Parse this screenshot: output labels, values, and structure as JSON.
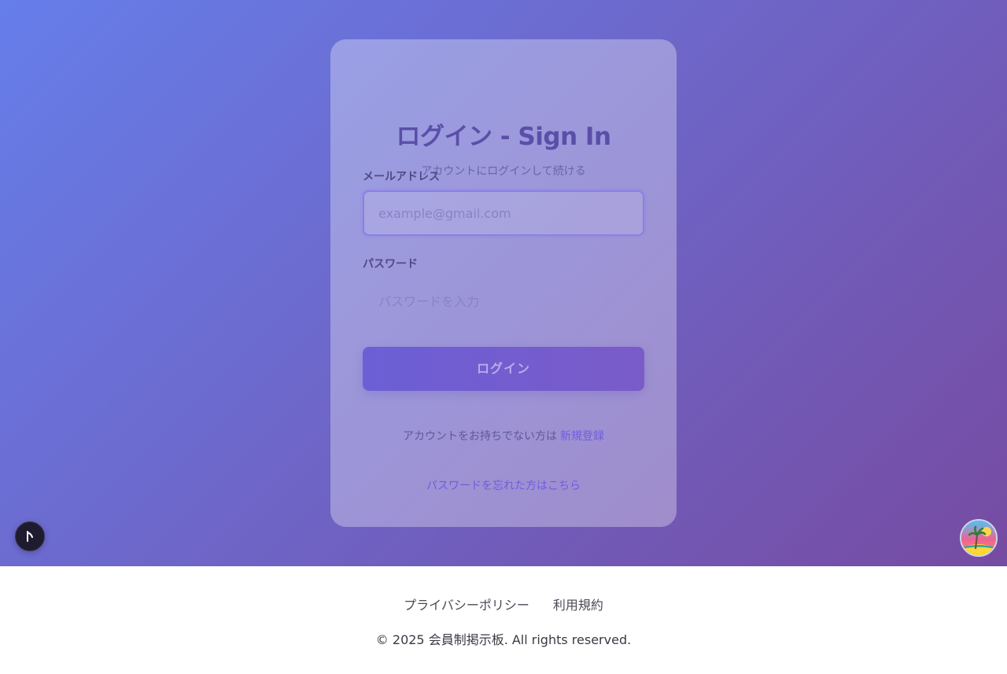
{
  "login": {
    "title": "ログイン - Sign In",
    "subtitle": "アカウントにログインして続ける",
    "email_label": "メールアドレス",
    "email_placeholder": "example@gmail.com",
    "password_label": "パスワード",
    "password_placeholder": "パスワードを入力",
    "submit_label": "ログイン",
    "no_account_text": "アカウントをお持ちでない方は",
    "signup_link": "新規登録",
    "forgot_link": "パスワードを忘れた方はこちら"
  },
  "footer": {
    "privacy_link": "プライバシーポリシー",
    "terms_link": "利用規約",
    "copyright": "© 2025 会員制掲示板. All rights reserved."
  },
  "widgets": {
    "cursor_icon": "cursor-icon",
    "avatar_icon": "beach-avatar-icon"
  },
  "colors": {
    "gradient_start": "#667eea",
    "gradient_end": "#764ba2",
    "accent": "#6f5ce0"
  }
}
